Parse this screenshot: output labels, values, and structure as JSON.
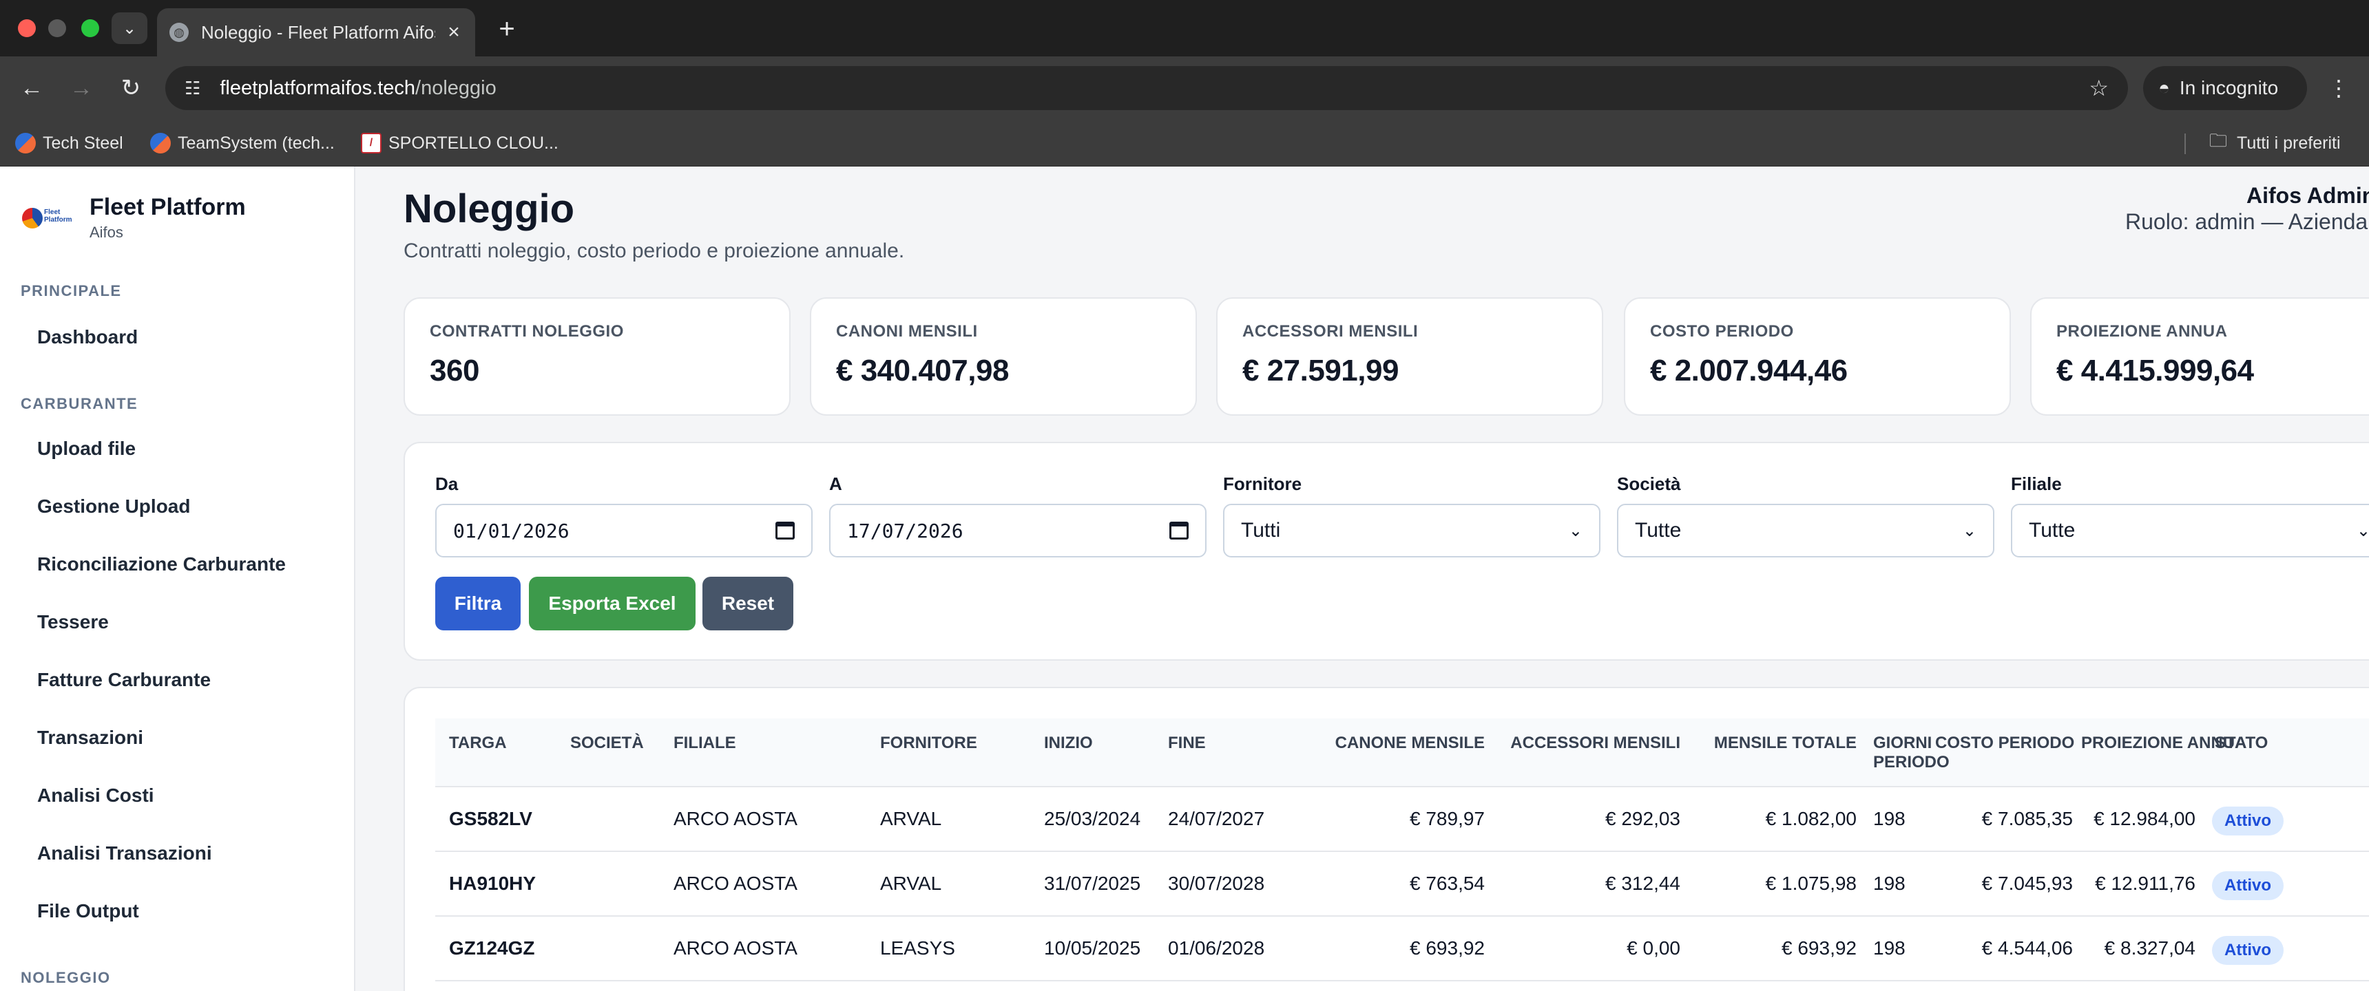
{
  "browser": {
    "tab_title": "Noleggio - Fleet Platform Aifos",
    "tab_close": "×",
    "new_tab": "+",
    "url_host": "fleetplatformaifos.tech",
    "url_path": "/noleggio",
    "incognito_label": "In incognito",
    "bookmarks": [
      {
        "label": "Tech Steel"
      },
      {
        "label": "TeamSystem (tech..."
      },
      {
        "label": "SPORTELLO CLOU..."
      }
    ],
    "all_bookmarks": "Tutti i preferiti"
  },
  "sidebar": {
    "brand_title": "Fleet Platform",
    "brand_subtitle": "Aifos",
    "logo_text": "Fleet Platform",
    "sections": [
      {
        "label": "PRINCIPALE",
        "items": [
          "Dashboard"
        ]
      },
      {
        "label": "CARBURANTE",
        "items": [
          "Upload file",
          "Gestione Upload",
          "Riconciliazione Carburante",
          "Tessere",
          "Fatture Carburante",
          "Transazioni",
          "Analisi Costi",
          "Analisi Transazioni",
          "File Output"
        ]
      },
      {
        "label": "NOLEGGIO",
        "items": []
      }
    ]
  },
  "header": {
    "title": "Noleggio",
    "subtitle": "Contratti noleggio, costo periodo e proiezione annuale.",
    "user_name": "Aifos Admin",
    "user_role": "Ruolo: admin — Azienda"
  },
  "stats": [
    {
      "label": "CONTRATTI NOLEGGIO",
      "value": "360"
    },
    {
      "label": "CANONI MENSILI",
      "value": "€ 340.407,98"
    },
    {
      "label": "ACCESSORI MENSILI",
      "value": "€ 27.591,99"
    },
    {
      "label": "COSTO PERIODO",
      "value": "€ 2.007.944,46"
    },
    {
      "label": "PROIEZIONE ANNUA",
      "value": "€ 4.415.999,64"
    }
  ],
  "filters": {
    "da_label": "Da",
    "da_value": "01/01/2026",
    "a_label": "A",
    "a_value": "17/07/2026",
    "fornitore_label": "Fornitore",
    "fornitore_value": "Tutti",
    "societa_label": "Società",
    "societa_value": "Tutte",
    "filiale_label": "Filiale",
    "filiale_value": "Tutte",
    "btn_filtra": "Filtra",
    "btn_excel": "Esporta Excel",
    "btn_reset": "Reset"
  },
  "table": {
    "headers": {
      "targa": "TARGA",
      "societa": "SOCIETÀ",
      "filiale": "FILIALE",
      "fornitore": "FORNITORE",
      "inizio": "INIZIO",
      "fine": "FINE",
      "canone": "CANONE MENSILE",
      "accessori": "ACCESSORI MENSILI",
      "mensile": "MENSILE TOTALE",
      "giorni1": "GIORNI",
      "giorni2": "PERIODO",
      "costo": "COSTO PERIODO",
      "proiezione": "PROIEZIONE ANNUA",
      "stato": "STATO"
    },
    "rows": [
      {
        "targa": "GS582LV",
        "societa": "",
        "filiale": "ARCO AOSTA",
        "fornitore": "ARVAL",
        "inizio": "25/03/2024",
        "fine": "24/07/2027",
        "canone": "€ 789,97",
        "accessori": "€ 292,03",
        "mensile": "€ 1.082,00",
        "giorni": "198",
        "costo": "€ 7.085,35",
        "proiezione": "€ 12.984,00",
        "stato": "Attivo"
      },
      {
        "targa": "HA910HY",
        "societa": "",
        "filiale": "ARCO AOSTA",
        "fornitore": "ARVAL",
        "inizio": "31/07/2025",
        "fine": "30/07/2028",
        "canone": "€ 763,54",
        "accessori": "€ 312,44",
        "mensile": "€ 1.075,98",
        "giorni": "198",
        "costo": "€ 7.045,93",
        "proiezione": "€ 12.911,76",
        "stato": "Attivo"
      },
      {
        "targa": "GZ124GZ",
        "societa": "",
        "filiale": "ARCO AOSTA",
        "fornitore": "LEASYS",
        "inizio": "10/05/2025",
        "fine": "01/06/2028",
        "canone": "€ 693,92",
        "accessori": "€ 0,00",
        "mensile": "€ 693,92",
        "giorni": "198",
        "costo": "€ 4.544,06",
        "proiezione": "€ 8.327,04",
        "stato": "Attivo"
      }
    ]
  }
}
